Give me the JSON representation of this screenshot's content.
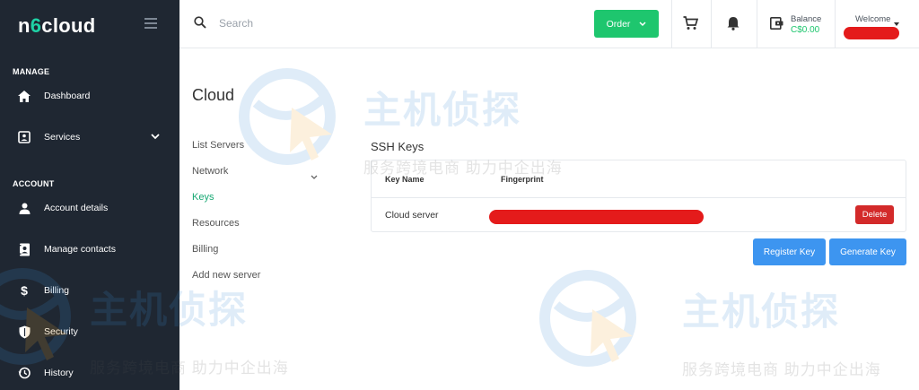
{
  "logo": {
    "part1": "n",
    "accent": "6",
    "part2": "cloud"
  },
  "sidebar": {
    "sections": [
      {
        "label": "MANAGE"
      },
      {
        "label": "ACCOUNT"
      }
    ],
    "items": [
      {
        "label": "Dashboard",
        "icon": "home-icon"
      },
      {
        "label": "Services",
        "icon": "services-icon"
      },
      {
        "label": "Account details",
        "icon": "user-icon"
      },
      {
        "label": "Manage contacts",
        "icon": "contacts-icon"
      },
      {
        "label": "Billing",
        "icon": "dollar-icon"
      },
      {
        "label": "Security",
        "icon": "shield-icon"
      },
      {
        "label": "History",
        "icon": "history-icon"
      }
    ]
  },
  "topbar": {
    "search_placeholder": "Search",
    "order_label": "Order",
    "balance_label": "Balance",
    "balance_value": "C$0.00",
    "welcome_label": "Welcome"
  },
  "cloud": {
    "title": "Cloud",
    "nav": [
      "List Servers",
      "Network",
      "Keys",
      "Resources",
      "Billing",
      "Add new server"
    ]
  },
  "ssh": {
    "title": "SSH Keys",
    "columns": [
      "Key Name",
      "Fingerprint"
    ],
    "rows": [
      {
        "name": "Cloud server",
        "action": "Delete"
      }
    ],
    "register_label": "Register Key",
    "generate_label": "Generate Key"
  },
  "watermark": {
    "title": "主机侦探",
    "subtitle": "服务跨境电商 助力中企出海"
  },
  "colors": {
    "sidebar_bg": "#1f2732",
    "accent_green": "#1ec66e",
    "active_link": "#18a873",
    "primary_blue": "#3d95f0",
    "danger_red": "#d32a2a"
  }
}
